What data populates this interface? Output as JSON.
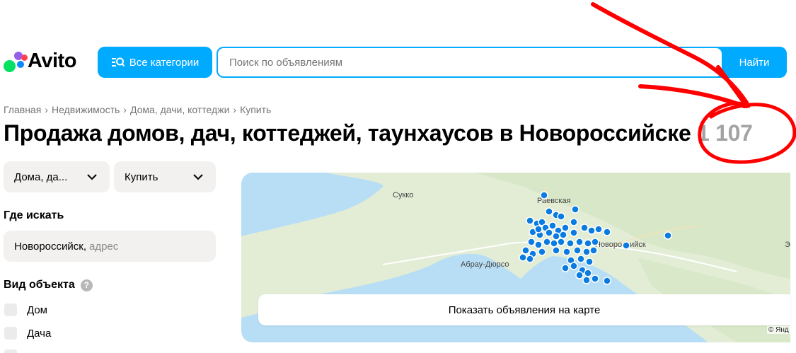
{
  "header": {
    "logo_text": "Avito",
    "categories_button": "Все категории",
    "search_placeholder": "Поиск по объявлениям",
    "find_button": "Найти"
  },
  "breadcrumbs": [
    "Главная",
    "Недвижимость",
    "Дома, дачи, коттеджи",
    "Купить"
  ],
  "page": {
    "title": "Продажа домов, дач, коттеджей, таунхаусов в Новороссийске",
    "count": "1 107"
  },
  "filters": {
    "type_select": "Дома, да...",
    "deal_select": "Купить",
    "where_label": "Где искать",
    "where_value": "Новороссийск,",
    "where_hint": "адрес",
    "object_type_label": "Вид объекта",
    "help_icon": "?",
    "object_types": [
      "Дом",
      "Дача"
    ]
  },
  "map": {
    "labels": {
      "sukko": "Сукко",
      "raevskaya": "Раевская",
      "abrau": "Абрау-Дюрсо",
      "novoross": "Новороссийск"
    },
    "show_on_map_button": "Показать объявления на карте",
    "copyright": "© Янд",
    "marker_color": "#0a7be0",
    "sea_color": "#b8def5",
    "land_color": "#e6efd9"
  },
  "annotation": {
    "color": "#ff0000",
    "description_icon": "red-arrow-and-circle"
  }
}
